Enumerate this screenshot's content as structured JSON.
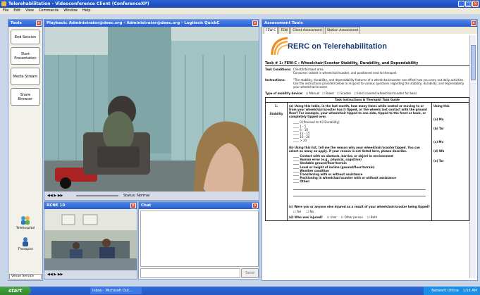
{
  "window": {
    "title": "Telerehabilitation - Videoconference Client (ConferenceXP)"
  },
  "menu": [
    "File",
    "Edit",
    "View",
    "Commands",
    "Window",
    "Help"
  ],
  "tools": {
    "title": "Tools",
    "buttons": [
      "End Session",
      "Start Presentation",
      "Media Stream",
      "Share Browser"
    ],
    "icons": [
      "Telehospital",
      "Therapist"
    ],
    "venue_label": "Venue Service"
  },
  "playback": {
    "title": "Playback: Administrator@deec.org - Administrator@deec.org - Logitech QuickC",
    "status": "Status: Normal"
  },
  "rcnav": {
    "title": "RCNE 10"
  },
  "chat": {
    "title": "Chat",
    "send_label": "Send"
  },
  "assessment": {
    "title": "Assessment Tools",
    "tabs": [
      "FEW-C",
      "FEW",
      "Client Assessment",
      "Station Assessment"
    ],
    "brand": "RERC on Telerehabilitation",
    "task_title": "Task # 1:   FEW-C : Wheelchair/Scooter Stability, Durability, and Dependability",
    "task_conditions_label": "Task Conditions:",
    "task_conditions": [
      "Client/Informant area",
      "Consumer seated in wheelchair/scooter, and positioned next to therapist"
    ],
    "instructions_label": "Instructions:",
    "instructions": "\"The stability, durability, and dependability features of a wheelchair/scooter can affect how you carry out daily activities. Use the instructions provided below to respond to various questions regarding the stability, durability, and dependability your wheelchair/scooter.",
    "mobility_label": "Type of mobility device:",
    "mobility_options": [
      "Manual",
      "Power",
      "Scooter",
      "Hard covered wheelchair/scooter for basic"
    ],
    "table_header": "Task Instructions & Therapist Task Guide",
    "row_number": "1.",
    "row_label": "Stability",
    "q_a": "(a) Using this table, in the last month, how many times while seated or moving to or from your wheelchair/scooter has it tipped, or the wheels lost contact with the ground floor? For example, your wheelchair tipped to one side, tipped to the front or back, or completely tipped over.",
    "counts": [
      "0  [Proceed to #2 Durability]",
      "1 - 5",
      "6 - 10",
      "11 - 15",
      "16 - 20",
      "> 20"
    ],
    "q_b": "(b) Using this list, tell me the reason why your wheelchair/scooter tipped. You can select as many as apply. If your reason is not listed here, please describe.",
    "reasons": [
      "Contact with an obstacle, barrier, or object in environment",
      "Human error (e.g., physical, cognitive)",
      "Unstable ground/floor/terrain",
      "Level or height of incline (ground/floor/terrain)",
      "Weather condition",
      "Transferring with or without assistance",
      "Positioning in wheelchair/scooter with or without assistance",
      "Other:"
    ],
    "q_c": "(c) Were you or anyone else injured as a result of your wheelchair/scooter being tipped?",
    "yes_no": [
      "Yes",
      "No"
    ],
    "q_d": "(d) Who was injured?",
    "injured": [
      "User",
      "Other person",
      "Both"
    ],
    "side_header": "Using this",
    "side_items": [
      "(a) Ma",
      "(b) Tal",
      "(c) Mo",
      "(d) Wh",
      "(e) Tar"
    ]
  },
  "taskbar": {
    "start": "start",
    "items": [
      "Inbox - Microsoft Out..."
    ],
    "tray_label": "Network Online",
    "clock": "1:55 AM"
  }
}
